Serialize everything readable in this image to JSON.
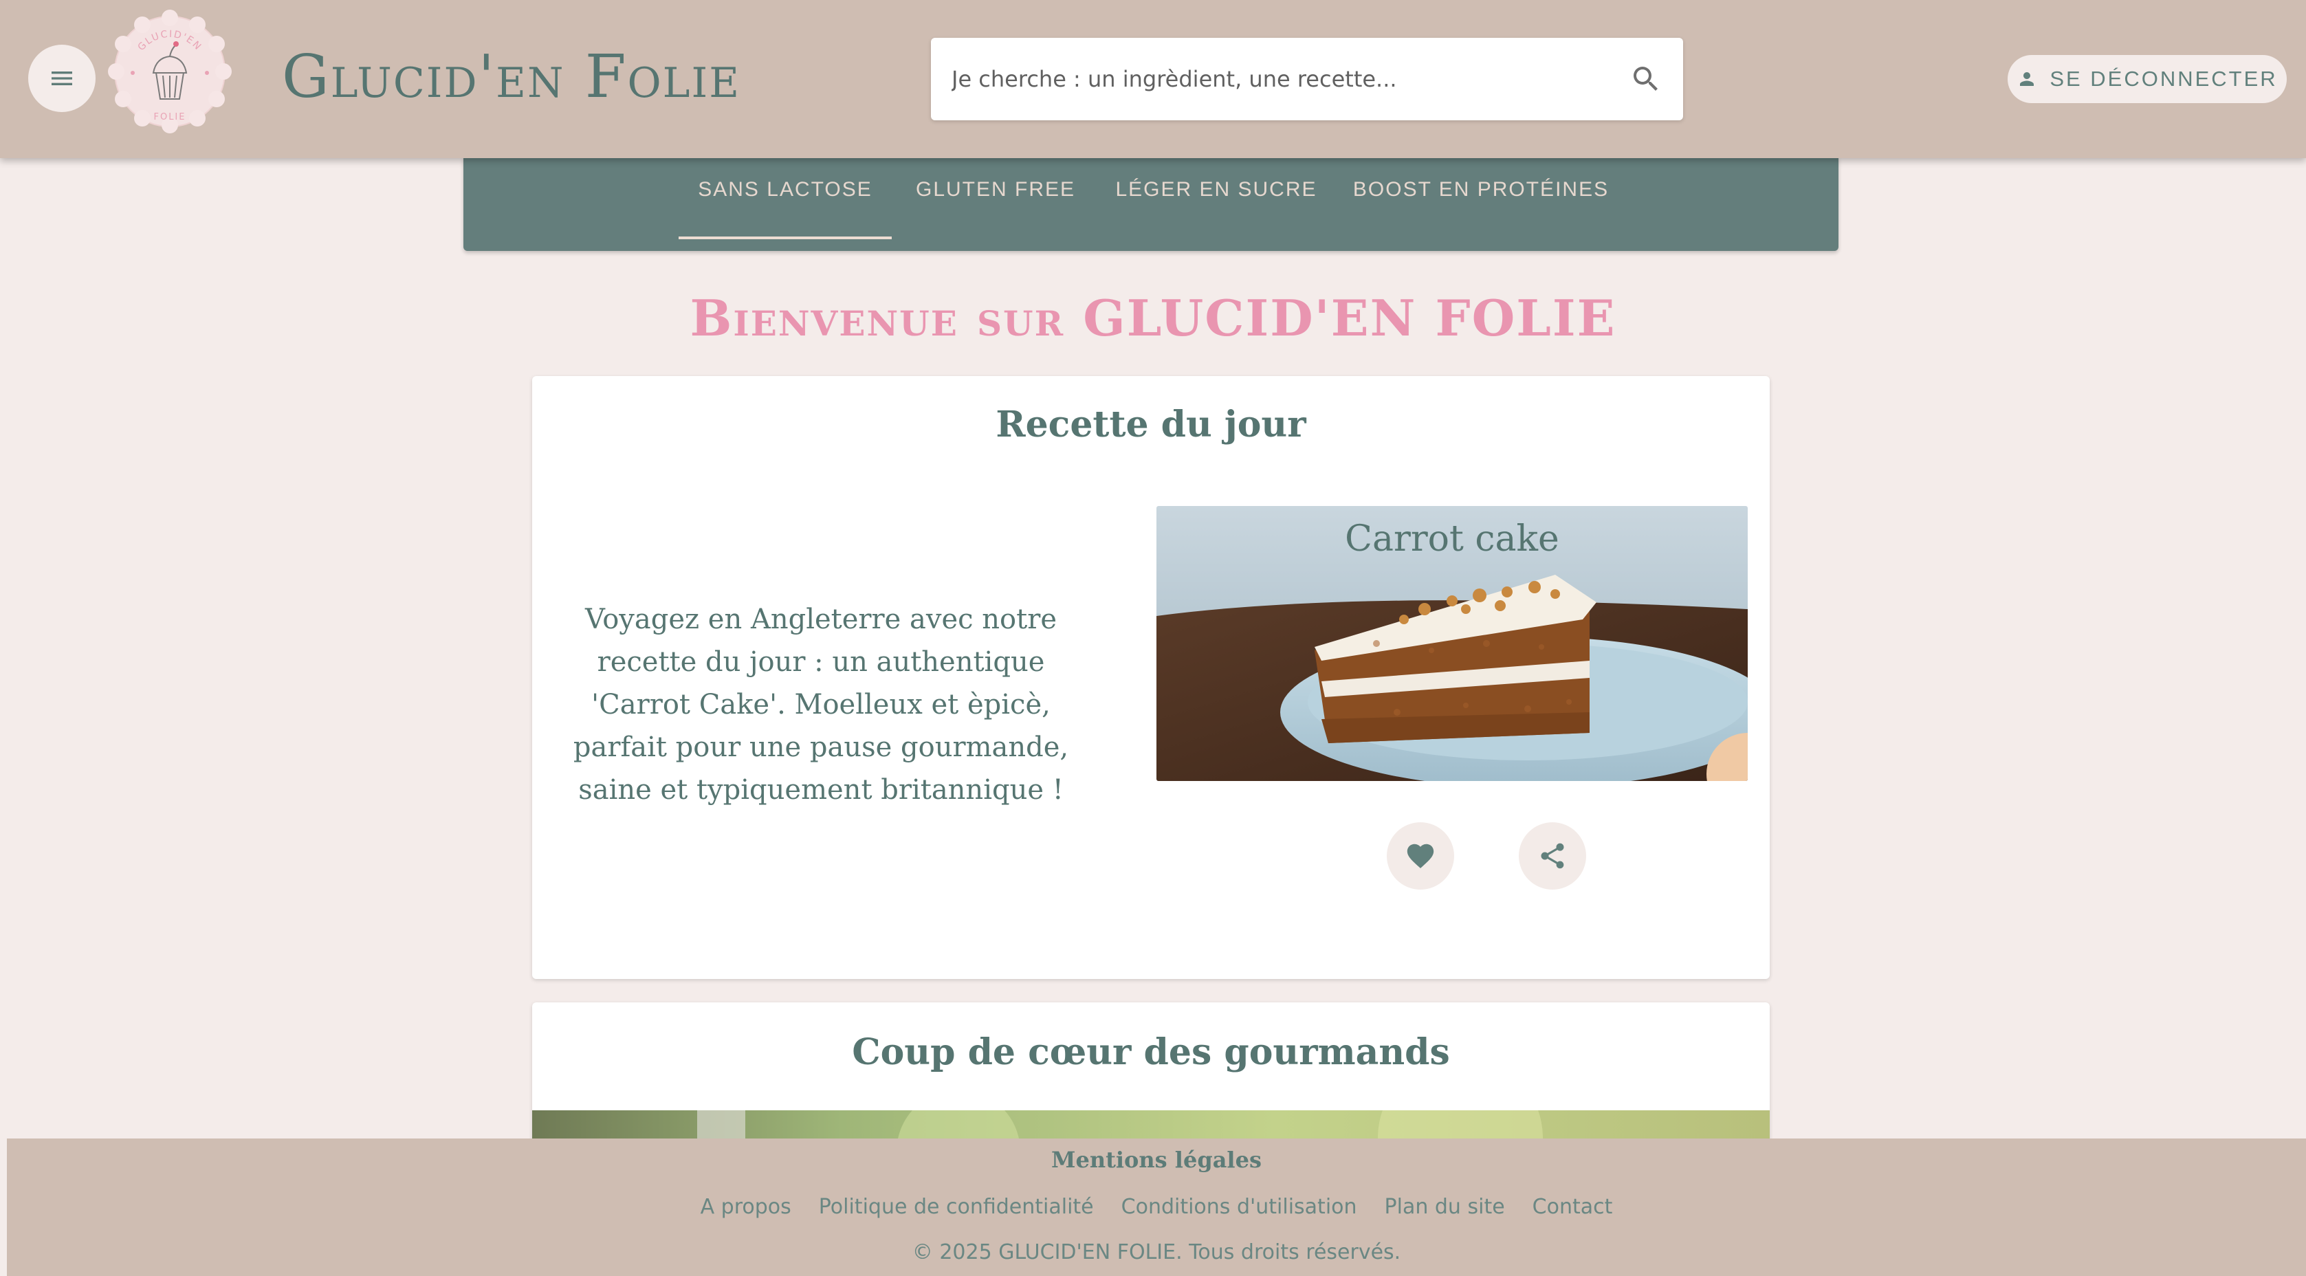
{
  "header": {
    "brand": "Glucid'en Folie",
    "logo_text_top": "GLUCID'EN",
    "logo_text_bottom": "FOLIE",
    "search_placeholder": "Je cherche : un ingrèdient, une recette...",
    "logout_label": "SE DÉCONNECTER"
  },
  "tabs": [
    {
      "label": "SANS LACTOSE",
      "active": true
    },
    {
      "label": "GLUTEN FREE",
      "active": false
    },
    {
      "label": "LÉGER EN SUCRE",
      "active": false
    },
    {
      "label": "BOOST EN PROTÉINES",
      "active": false
    }
  ],
  "main": {
    "welcome": "Bienvenue sur GLUCID'EN FOLIE",
    "recipe_of_day": {
      "title": "Recette du jour",
      "description": "Voyagez en Angleterre avec notre recette du jour : un authentique 'Carrot Cake'. Moelleux et èpicè, parfait pour une pause gourmande, saine et typiquement britannique !",
      "recipe_name": "Carrot cake"
    },
    "favorites": {
      "title": "Coup de cœur des gourmands"
    }
  },
  "footer": {
    "title": "Mentions légales",
    "links": [
      "A propos",
      "Politique de confidentialité",
      "Conditions d'utilisation",
      "Plan du site",
      "Contact"
    ],
    "copyright": "© 2025 GLUCID'EN FOLIE. Tous droits réservés."
  },
  "colors": {
    "header_bg": "#cfbdb2",
    "tabs_bg": "#647e7c",
    "page_bg": "#f4ecea",
    "accent_pink": "#e995b0",
    "text_green": "#567571"
  }
}
